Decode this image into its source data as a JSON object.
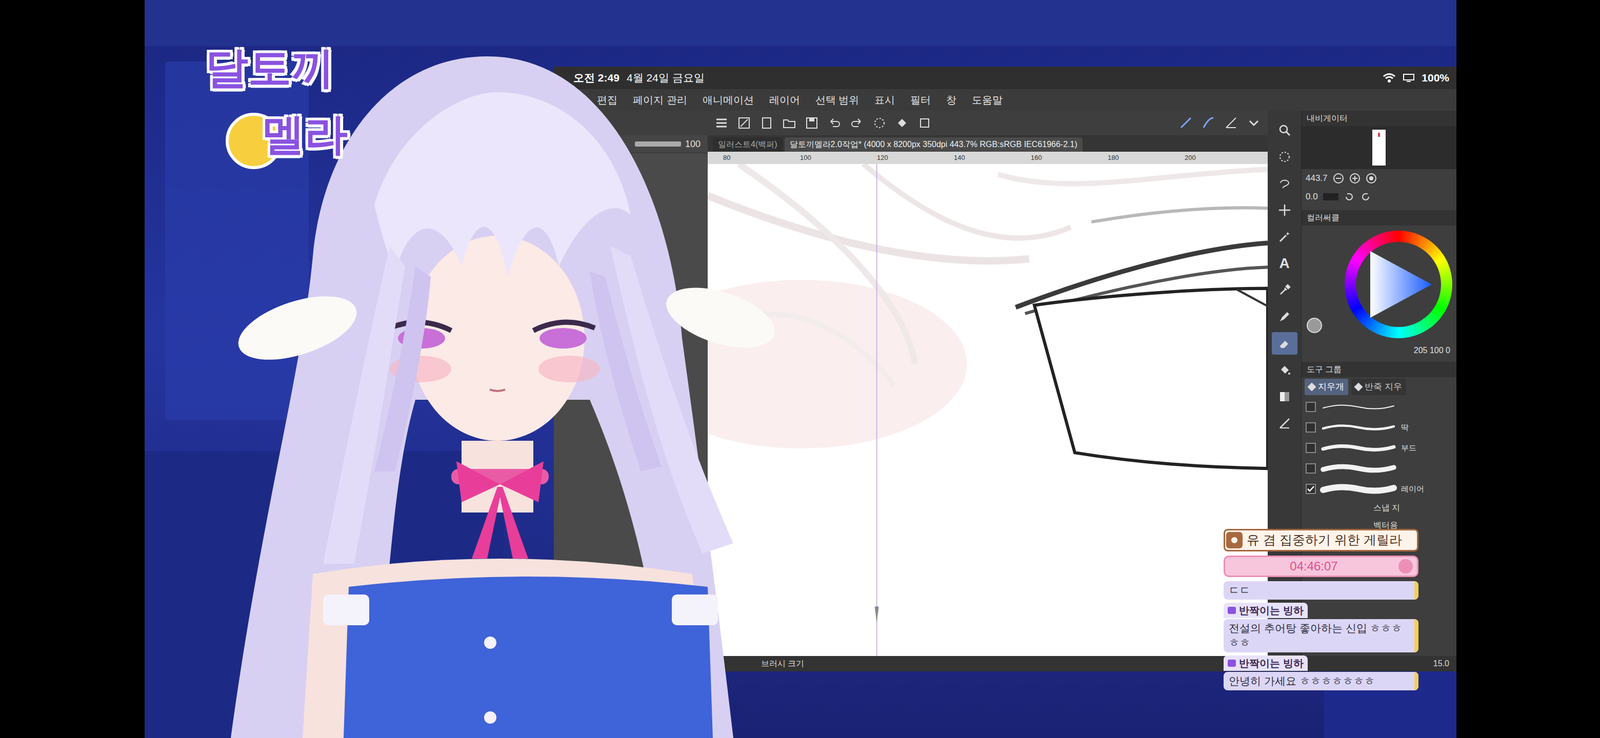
{
  "logo": {
    "top": "달토끼",
    "bottom": "멜라"
  },
  "status_bar": {
    "time": "오전 2:49",
    "date": "4월 24일 금요일",
    "battery": "100%"
  },
  "menu": [
    "편집",
    "페이지 관리",
    "애니메이션",
    "레이어",
    "선택 범위",
    "표시",
    "필터",
    "창",
    "도움말"
  ],
  "layer_opacity": "100",
  "tabs": [
    {
      "label": "일러스트4(백퍼)",
      "selected": false
    },
    {
      "label": "달토끼멜라2.0작업* (4000 x 8200px 350dpi 443.7% RGB:sRGB IEC61966-2.1)",
      "selected": true
    }
  ],
  "ruler": [
    "80",
    "100",
    "120",
    "140",
    "160",
    "180",
    "200"
  ],
  "tools": [
    {
      "kind": "zoom",
      "selected": false
    },
    {
      "kind": "select",
      "selected": false
    },
    {
      "kind": "lasso",
      "selected": false
    },
    {
      "kind": "move",
      "selected": false
    },
    {
      "kind": "wand",
      "selected": false
    },
    {
      "kind": "text",
      "glyph": "A",
      "selected": false
    },
    {
      "kind": "eyedropper",
      "selected": false
    },
    {
      "kind": "pen",
      "selected": false
    },
    {
      "kind": "eraser",
      "selected": true
    },
    {
      "kind": "fill",
      "selected": false
    },
    {
      "kind": "gradient",
      "selected": false
    },
    {
      "kind": "figure",
      "selected": false
    }
  ],
  "navigator": {
    "title": "내비게이터",
    "zoom": "443.7",
    "angle": "0.0"
  },
  "color_panel": {
    "title": "컬러써클",
    "values": "205 100 0"
  },
  "tool_group": {
    "title": "도구 그룹",
    "tabs": [
      {
        "label": "지우개",
        "selected": true
      },
      {
        "label": "반죽 지우",
        "selected": false
      }
    ],
    "brushes": [
      {
        "checked": false
      },
      {
        "label": "딱",
        "checked": false
      },
      {
        "label": "부드",
        "checked": false
      },
      {
        "checked": false
      },
      {
        "label": "레이어",
        "checked": true
      }
    ],
    "extra": [
      "스냅 지",
      "벡터용"
    ]
  },
  "bottom_bar": {
    "label": "브러시 크기",
    "value": "15.0"
  },
  "stream": {
    "banner": "유 겸 집중하기 위한 게릴라",
    "timer": "04:46:07"
  },
  "chat": [
    {
      "text": "ㄷㄷ"
    },
    {
      "user": "반짝이는 빙하",
      "text": "전설의 추어탕 좋아하는 신입 ㅎㅎㅎㅎㅎ"
    },
    {
      "user": "반짝이는 빙하",
      "text": "안녕히 가세요 ㅎㅎㅎㅎㅎㅎㅎ"
    }
  ]
}
